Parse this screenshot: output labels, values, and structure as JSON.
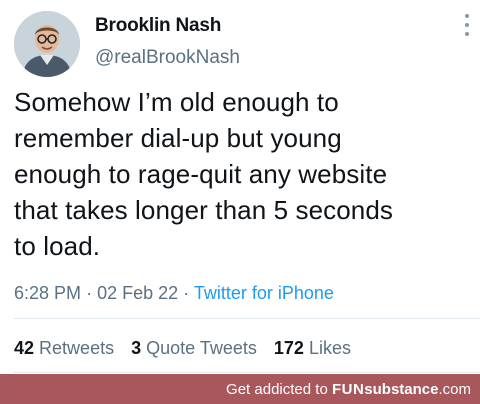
{
  "author": {
    "name": "Brooklin Nash",
    "handle": "@realBrookNash"
  },
  "tweet": {
    "lines": [
      "Somehow I’m old enough to",
      "remember dial-up but young",
      "enough to rage-quit any website",
      "that takes longer than 5 seconds",
      "to load."
    ]
  },
  "meta": {
    "time": "6:28 PM",
    "separator": "·",
    "date": "02 Feb 22",
    "source": "Twitter for iPhone"
  },
  "stats": {
    "retweets_count": "42",
    "retweets_label": "Retweets",
    "quotes_count": "3",
    "quotes_label": "Quote Tweets",
    "likes_count": "172",
    "likes_label": "Likes"
  },
  "footer": {
    "prefix": "Get addicted to ",
    "brand_fun": "FUN",
    "brand_rest": "substance",
    "brand_suffix": ".com"
  },
  "colors": {
    "handle_gray": "#5b7083",
    "link_blue": "#1d9bf0",
    "footer_bg": "#a8585c"
  },
  "icons": [
    "profile-avatar",
    "more-options-icon"
  ]
}
